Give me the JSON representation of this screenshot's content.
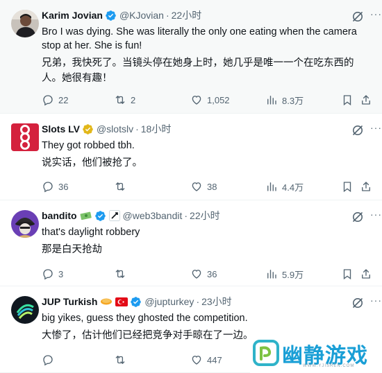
{
  "tweets": [
    {
      "name": "Karim Jovian",
      "handle": "@KJovian",
      "time": "22小时",
      "text": "Bro I was dying. She was literally the only one eating when the camera stop at her. She is fun!",
      "translation": "兄弟，我快死了。当镜头停在她身上时，她几乎是唯一一个在吃东西的人。她很有趣！",
      "replies": "22",
      "retweets": "2",
      "likes": "1,052",
      "views": "8.3万"
    },
    {
      "name": "Slots LV",
      "handle": "@slotslv",
      "time": "18小时",
      "text": "They got robbed tbh.",
      "translation": "说实话，他们被抢了。",
      "replies": "36",
      "retweets": "",
      "likes": "38",
      "views": "4.4万"
    },
    {
      "name": "bandito",
      "handle": "@web3bandit",
      "time": "22小时",
      "text": "that's daylight robbery",
      "translation": "那是白天抢劫",
      "replies": "3",
      "retweets": "",
      "likes": "36",
      "views": "5.9万"
    },
    {
      "name": "JUP Turkish",
      "handle": "@jupturkey",
      "time": "23小时",
      "text": "big yikes, guess they ghosted the competition.",
      "translation": "大惨了，估计他们已经把竞争对手晾在了一边。",
      "replies": "",
      "retweets": "",
      "likes": "447",
      "views": ""
    }
  ],
  "separator": "·",
  "more_label": "···",
  "watermark": {
    "title": "幽静游戏",
    "subtitle": "WWW.YJISREN.COM"
  },
  "colors": {
    "accent": "#1d9bf0",
    "gold": "#e2b719",
    "muted": "#536471",
    "highlight_bg": "#f7f9f9"
  },
  "icons": [
    "grok-icon",
    "more-icon",
    "reply-icon",
    "retweet-icon",
    "like-icon",
    "views-icon",
    "bookmark-icon",
    "share-icon",
    "verified-icon",
    "gold-verified-icon"
  ]
}
